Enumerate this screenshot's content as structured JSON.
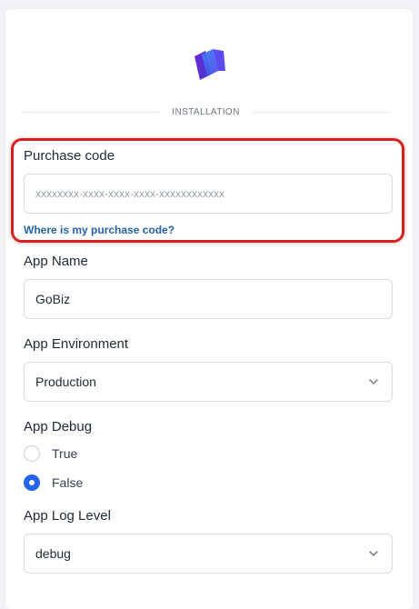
{
  "header": {
    "section_title": "INSTALLATION"
  },
  "purchase": {
    "label": "Purchase code",
    "placeholder": "xxxxxxxx-xxxx-xxxx-xxxx-xxxxxxxxxxxx",
    "help_link": "Where is my purchase code?"
  },
  "app_name": {
    "label": "App Name",
    "value": "GoBiz"
  },
  "app_environment": {
    "label": "App Environment",
    "selected": "Production"
  },
  "app_debug": {
    "label": "App Debug",
    "options": [
      {
        "label": "True",
        "checked": false
      },
      {
        "label": "False",
        "checked": true
      }
    ]
  },
  "app_log_level": {
    "label": "App Log Level",
    "selected": "debug"
  },
  "icons": [
    "app-logo-icon",
    "chevron-down-icon",
    "radio-unchecked-icon",
    "radio-checked-icon"
  ],
  "colors": {
    "highlight": "#d61f1f",
    "link": "#2563a8",
    "radio_checked": "#2563eb"
  }
}
